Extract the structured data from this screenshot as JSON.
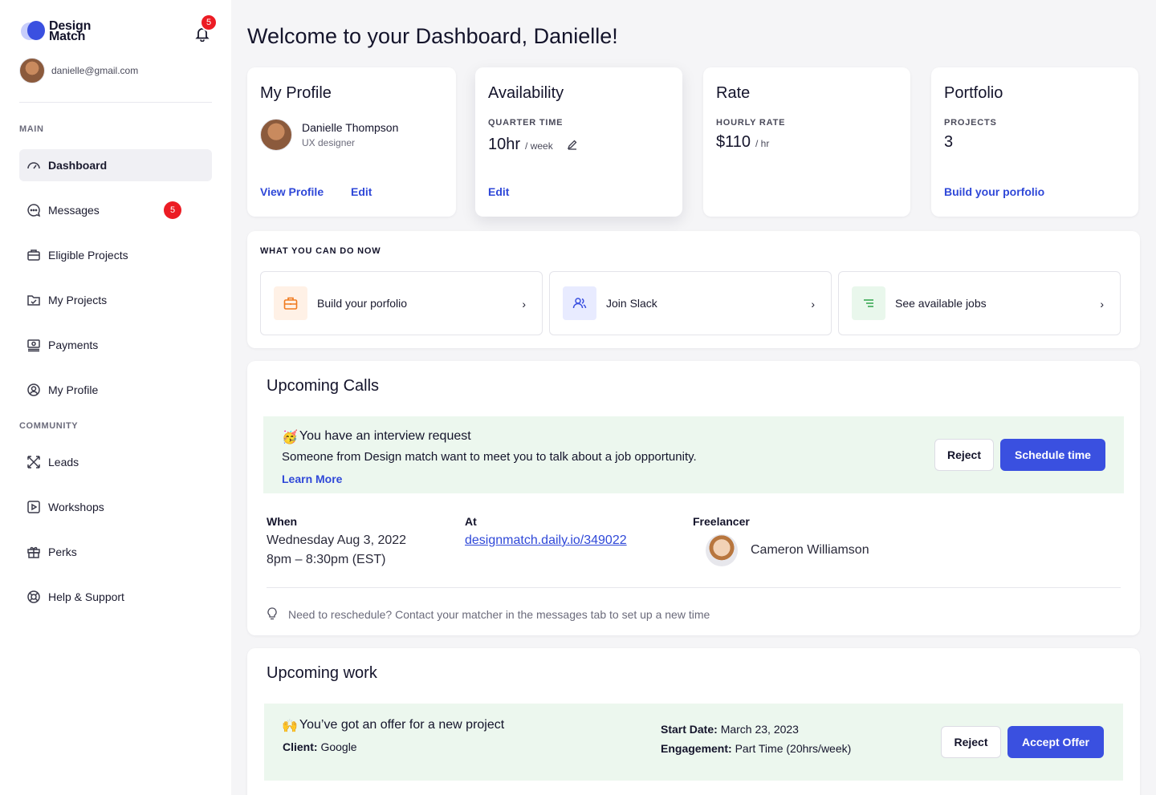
{
  "brand": {
    "line1": "Design",
    "line2": "Match",
    "accent": "#3a50e0"
  },
  "notifications": {
    "count": "5"
  },
  "user": {
    "email": "danielle@gmail.com"
  },
  "sidebar": {
    "main_label": "MAIN",
    "community_label": "COMMUNITY",
    "items": [
      {
        "label": "Dashboard",
        "icon": "gauge-icon"
      },
      {
        "label": "Messages",
        "icon": "chat-icon",
        "badge": "5"
      },
      {
        "label": "Eligible Projects",
        "icon": "briefcase-icon"
      },
      {
        "label": "My Projects",
        "icon": "folder-check-icon"
      },
      {
        "label": "Payments",
        "icon": "payment-icon"
      },
      {
        "label": "My Profile",
        "icon": "user-circle-icon"
      }
    ],
    "community_items": [
      {
        "label": "Leads",
        "icon": "arrows-icon"
      },
      {
        "label": "Workshops",
        "icon": "play-icon"
      },
      {
        "label": "Perks",
        "icon": "gift-icon"
      },
      {
        "label": "Help & Support",
        "icon": "lifebuoy-icon"
      }
    ]
  },
  "header": {
    "title": "Welcome to your Dashboard, Danielle!"
  },
  "profile_card": {
    "title": "My Profile",
    "name": "Danielle Thompson",
    "role": "UX designer",
    "view": "View Profile",
    "edit": "Edit"
  },
  "availability_card": {
    "title": "Availability",
    "label": "QUARTER TIME",
    "value": "10hr",
    "unit": "/ week",
    "edit": "Edit"
  },
  "rate_card": {
    "title": "Rate",
    "label": "HOURLY RATE",
    "value": "$110",
    "unit": "/ hr"
  },
  "portfolio_card": {
    "title": "Portfolio",
    "label": "PROJECTS",
    "value": "3",
    "link": "Build your porfolio"
  },
  "actions": {
    "title": "WHAT YOU CAN DO NOW",
    "items": [
      {
        "label": "Build your porfolio",
        "icon": "briefcase-icon"
      },
      {
        "label": "Join Slack",
        "icon": "users-icon"
      },
      {
        "label": "See available jobs",
        "icon": "list-icon"
      }
    ]
  },
  "calls": {
    "title": "Upcoming Calls",
    "banner_emoji": "🥳",
    "banner_title": "You have an interview request",
    "banner_text": "Someone from Design match want to meet you to talk about a job opportunity.",
    "learn_more": "Learn More",
    "reject": "Reject",
    "schedule": "Schedule time",
    "when_label": "When",
    "when_date": "Wednesday Aug 3, 2022",
    "when_time": "8pm – 8:30pm (EST)",
    "at_label": "At",
    "at_link": "designmatch.daily.io/349022",
    "freelancer_label": "Freelancer",
    "freelancer_name": "Cameron Williamson",
    "reschedule_q": "Need to reschedule?",
    "reschedule_text": "Contact your matcher in the messages tab to set up a new time"
  },
  "work": {
    "title": "Upcoming work",
    "emoji": "🙌",
    "offer_title": "You’ve got an offer for a new project",
    "client_label": "Client:",
    "client_value": "Google",
    "start_label": "Start Date:",
    "start_value": "March 23, 2023",
    "engagement_label": "Engagement:",
    "engagement_value": "Part Time (20hrs/week)",
    "reject": "Reject",
    "accept": "Accept Offer"
  }
}
